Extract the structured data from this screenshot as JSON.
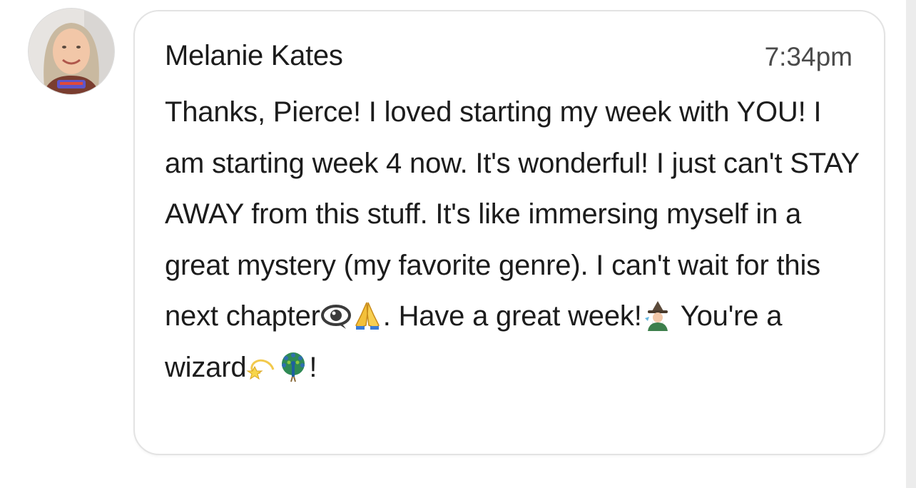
{
  "comment": {
    "author": "Melanie Kates",
    "time": "7:34pm",
    "text_segments": [
      "Thanks, Pierce! I loved starting my week with YOU! I am starting week 4 now. It's wonderful! I just can't STAY AWAY from this stuff. It's like immersing myself in a great mystery (my favorite genre). I can't wait for this next chapter",
      ". Have a great week!",
      " You're a wizard",
      "!"
    ],
    "emojis": [
      "eye-icon",
      "praying-hands-icon",
      "wizard-icon",
      "dizzy-star-icon",
      "peacock-icon"
    ]
  },
  "colors": {
    "bubble_border": "#e3e3e3",
    "text": "#1c1c1c",
    "time": "#4a4a4a"
  }
}
